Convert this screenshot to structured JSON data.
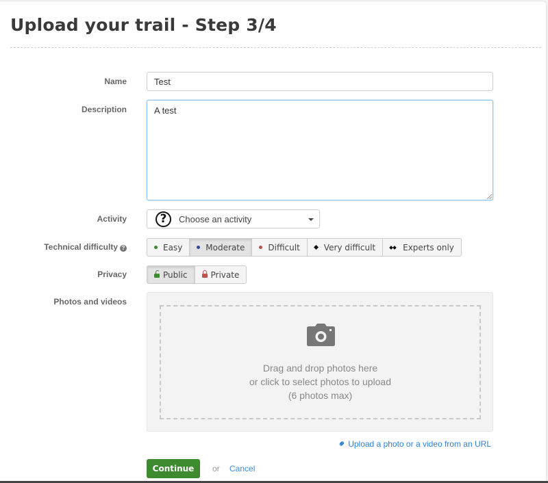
{
  "page": {
    "title": "Upload your trail - Step 3/4"
  },
  "form": {
    "name": {
      "label": "Name",
      "value": "Test"
    },
    "description": {
      "label": "Description",
      "value": "A test"
    },
    "activity": {
      "label": "Activity",
      "selected": "Choose an activity",
      "icon": "question-circle-icon"
    },
    "difficulty": {
      "label": "Technical difficulty",
      "help_icon": "question-circle-icon",
      "options": [
        {
          "label": "Easy",
          "icon": "green-dot",
          "color": "#3e8a2e",
          "active": false
        },
        {
          "label": "Moderate",
          "icon": "blue-dot",
          "color": "#2a4d9a",
          "active": true
        },
        {
          "label": "Difficult",
          "icon": "red-dot",
          "color": "#c0504d",
          "active": false
        },
        {
          "label": "Very difficult",
          "icon": "black-diamond",
          "color": "#111111",
          "active": false
        },
        {
          "label": "Experts only",
          "icon": "double-black-diamond",
          "color": "#111111",
          "active": false
        }
      ]
    },
    "privacy": {
      "label": "Privacy",
      "options": [
        {
          "label": "Public",
          "icon": "unlock-icon",
          "color": "#3e8a2e",
          "active": true
        },
        {
          "label": "Private",
          "icon": "lock-icon",
          "color": "#c0504d",
          "active": false
        }
      ]
    },
    "photos": {
      "label": "Photos and videos",
      "drop_line1": "Drag and drop photos here",
      "drop_line2": "or click to select photos to upload",
      "drop_line3": "(6 photos max)",
      "url_link": "Upload a photo or a video from an URL"
    }
  },
  "actions": {
    "continue_label": "Continue",
    "or_text": "or",
    "cancel_label": "Cancel"
  },
  "colors": {
    "primary_button": "#3e8a2e",
    "link": "#2f7fd1"
  }
}
